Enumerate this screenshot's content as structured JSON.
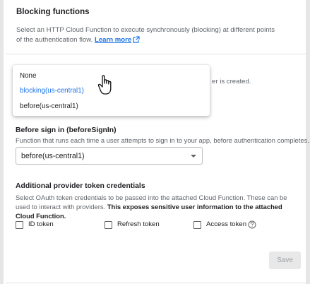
{
  "header": {
    "title": "Blocking functions",
    "description": "Select an HTTP Cloud Function to execute synchronously (blocking) at different points of the authentication flow.",
    "learn_more": "Learn more"
  },
  "partially_hidden_text": "er is created.",
  "dropdown": {
    "options": [
      "None",
      "blocking(us-central1)",
      "before(us-central1)"
    ],
    "highlighted_index": 1
  },
  "before_signin": {
    "title": "Before sign in (beforeSignIn)",
    "description": "Function that runs each time a user attempts to sign in to your app, before authentication completes.",
    "selected": "before(us-central1)"
  },
  "credentials": {
    "title": "Additional provider token credentials",
    "description": "Select OAuth token credentials to be passed into the attached Cloud Function. These can be used to interact with providers.",
    "warning": "This exposes sensitive user information to the attached Cloud Function.",
    "checkboxes": [
      {
        "label": "ID token",
        "checked": false
      },
      {
        "label": "Refresh token",
        "checked": false
      },
      {
        "label": "Access token",
        "checked": false
      }
    ]
  },
  "actions": {
    "save_label": "Save"
  },
  "colors": {
    "accent": "#1a73e8",
    "text": "#202124",
    "muted": "#5f6368"
  },
  "icons": [
    "open-in-new-icon",
    "hand-pointer-icon",
    "caret-down-icon",
    "help-circle-icon"
  ]
}
